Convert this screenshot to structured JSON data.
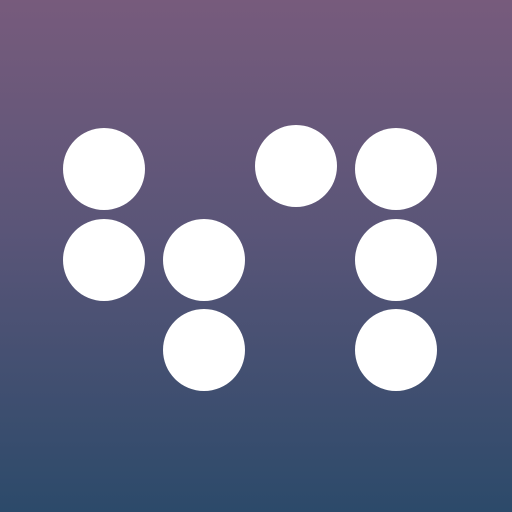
{
  "app_icon": {
    "icon_name": "braille-dots-logo-icon",
    "background_colors": {
      "top": "#775b7c",
      "middle": "#5a5578",
      "bottom": "#2c4a6a"
    },
    "dot_color": "#ffffff",
    "dot_count": 8
  }
}
